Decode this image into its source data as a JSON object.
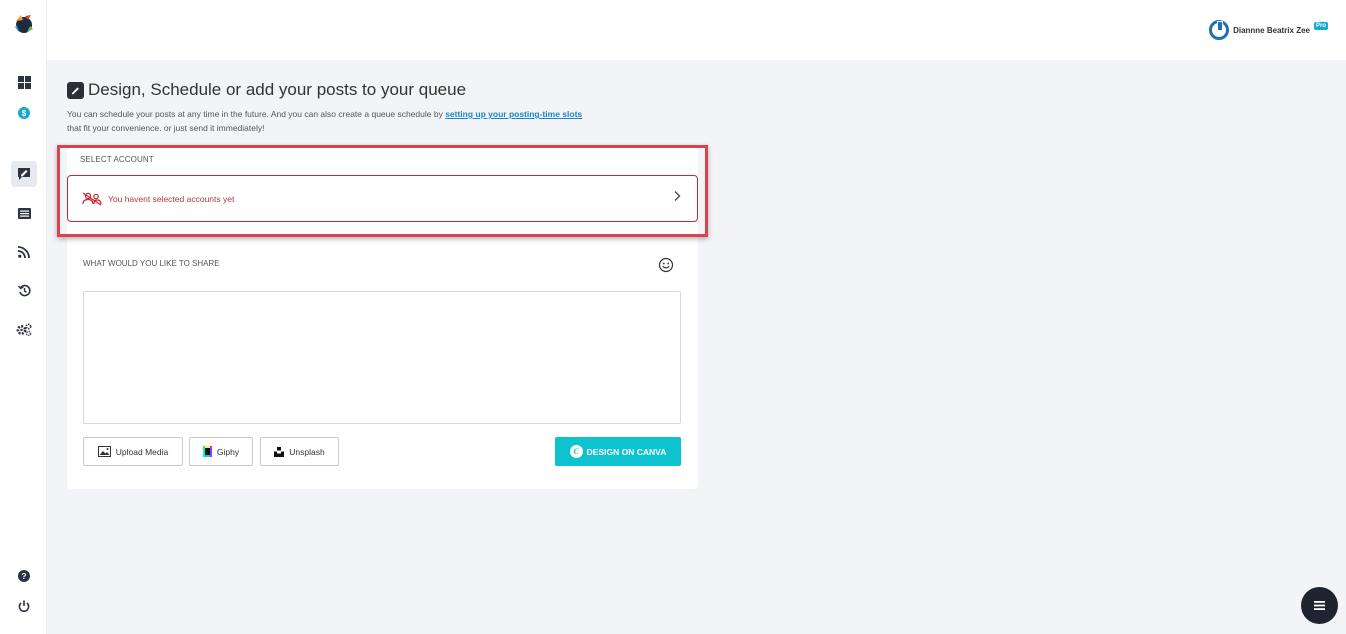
{
  "app": {
    "logo": "app-logo",
    "colors": {
      "accent": "#0ec3cf",
      "link": "#1a86c7",
      "error": "#c8282f",
      "sidebar_bg": "#ffffff",
      "page_bg": "#f3f4f8"
    }
  },
  "sidebar": {
    "items": [
      {
        "icon": "dashboard-icon",
        "active": false
      },
      {
        "icon": "dollar-coin-icon",
        "active": false
      },
      {
        "icon": "compose-post-icon",
        "active": true
      },
      {
        "icon": "queue-list-icon",
        "active": false
      },
      {
        "icon": "rss-feed-icon",
        "active": false
      },
      {
        "icon": "history-icon",
        "active": false
      },
      {
        "icon": "settings-gears-icon",
        "active": false
      }
    ],
    "bottom_items": [
      {
        "icon": "help-icon"
      },
      {
        "icon": "power-icon"
      }
    ]
  },
  "header": {
    "user_name": "Diannne Beatrix Zee",
    "badge": "Pro"
  },
  "page": {
    "title": "Design, Schedule or add your posts to your queue",
    "subtitle_pre": "You can schedule your posts at any time in the future. And you can also create a queue schedule by ",
    "subtitle_link": "setting up your posting-time slots",
    "subtitle_post": " that fit your convenience. or just send it immediately!"
  },
  "compose": {
    "select_account_label": "SELECT ACCOUNT",
    "no_account_message": "You havent selected accounts yet",
    "share_label": "WHAT WOULD YOU LIKE TO SHARE",
    "text_value": "",
    "buttons": {
      "upload_media": "Upload Media",
      "giphy": "Giphy",
      "unsplash": "Unsplash",
      "design_on_canva": "DESIGN ON CANVA"
    }
  }
}
